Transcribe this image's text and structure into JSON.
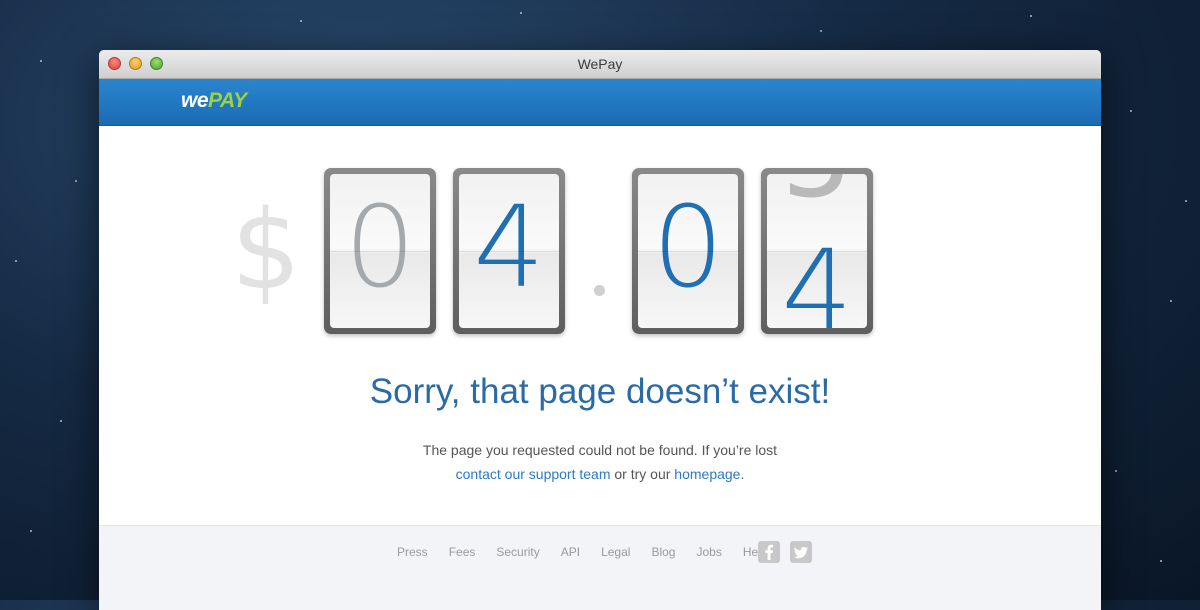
{
  "window": {
    "title": "WePay"
  },
  "logo": {
    "we": "we",
    "pay": "PAY"
  },
  "counter": {
    "currency": "$",
    "digits": [
      "0",
      "4",
      "0",
      "4"
    ],
    "ghost_digit": "5"
  },
  "headline": "Sorry, that page doesn’t exist!",
  "message": {
    "line1": "The page you requested could not be found. If you’re lost",
    "support_link": "contact our support team",
    "middle": "or try our",
    "homepage_link": "homepage",
    "end": "."
  },
  "footer": {
    "links": [
      "Press",
      "Fees",
      "Security",
      "API",
      "Legal",
      "Blog",
      "Jobs",
      "Help"
    ],
    "social": [
      "facebook-icon",
      "twitter-icon"
    ]
  },
  "colors": {
    "header_blue": "#1f75bf",
    "accent_green": "#9fd33b",
    "headline_blue": "#2a6aa5",
    "link_blue": "#2a7ac9"
  }
}
